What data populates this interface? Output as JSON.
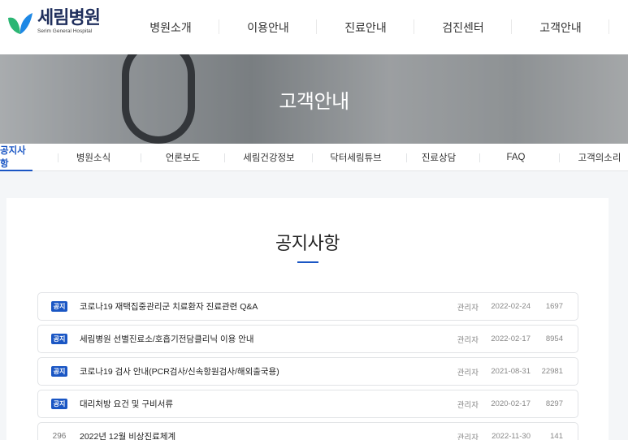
{
  "header": {
    "logo_ko": "세림병원",
    "logo_en": "Serim General Hospital",
    "menu": [
      "병원소개",
      "이용안내",
      "진료안내",
      "검진센터",
      "고객안내"
    ]
  },
  "hero": {
    "title": "고객안내"
  },
  "subnav": {
    "items": [
      "공지사항",
      "병원소식",
      "언론보도",
      "세림건강정보",
      "닥터세림튜브",
      "진료상담",
      "FAQ",
      "고객의소리"
    ],
    "active": "공지사항"
  },
  "board": {
    "title": "공지사항",
    "rows": [
      {
        "label": "공지",
        "title": "코로나19 재택집중관리군 치료환자 진료관련 Q&A",
        "author": "관리자",
        "date": "2022-02-24",
        "views": "1697"
      },
      {
        "label": "공지",
        "title": "세림병원 선별진료소/호흡기전담클리닉 이용 안내",
        "author": "관리자",
        "date": "2022-02-17",
        "views": "8954"
      },
      {
        "label": "공지",
        "title": "코로나19 검사 안내(PCR검사/신속항원검사/해외출국용)",
        "author": "관리자",
        "date": "2021-08-31",
        "views": "22981"
      },
      {
        "label": "공지",
        "title": "대리처방 요건 및 구비서류",
        "author": "관리자",
        "date": "2020-02-17",
        "views": "8297"
      },
      {
        "label": "296",
        "title": "2022년 12월 비상진료체계",
        "author": "관리자",
        "date": "2022-11-30",
        "views": "141"
      }
    ]
  },
  "colors": {
    "brand": "#1a56c4",
    "logo_navy": "#1f2e5c",
    "logo_green": "#2bb673",
    "logo_blue": "#1e88e5"
  }
}
